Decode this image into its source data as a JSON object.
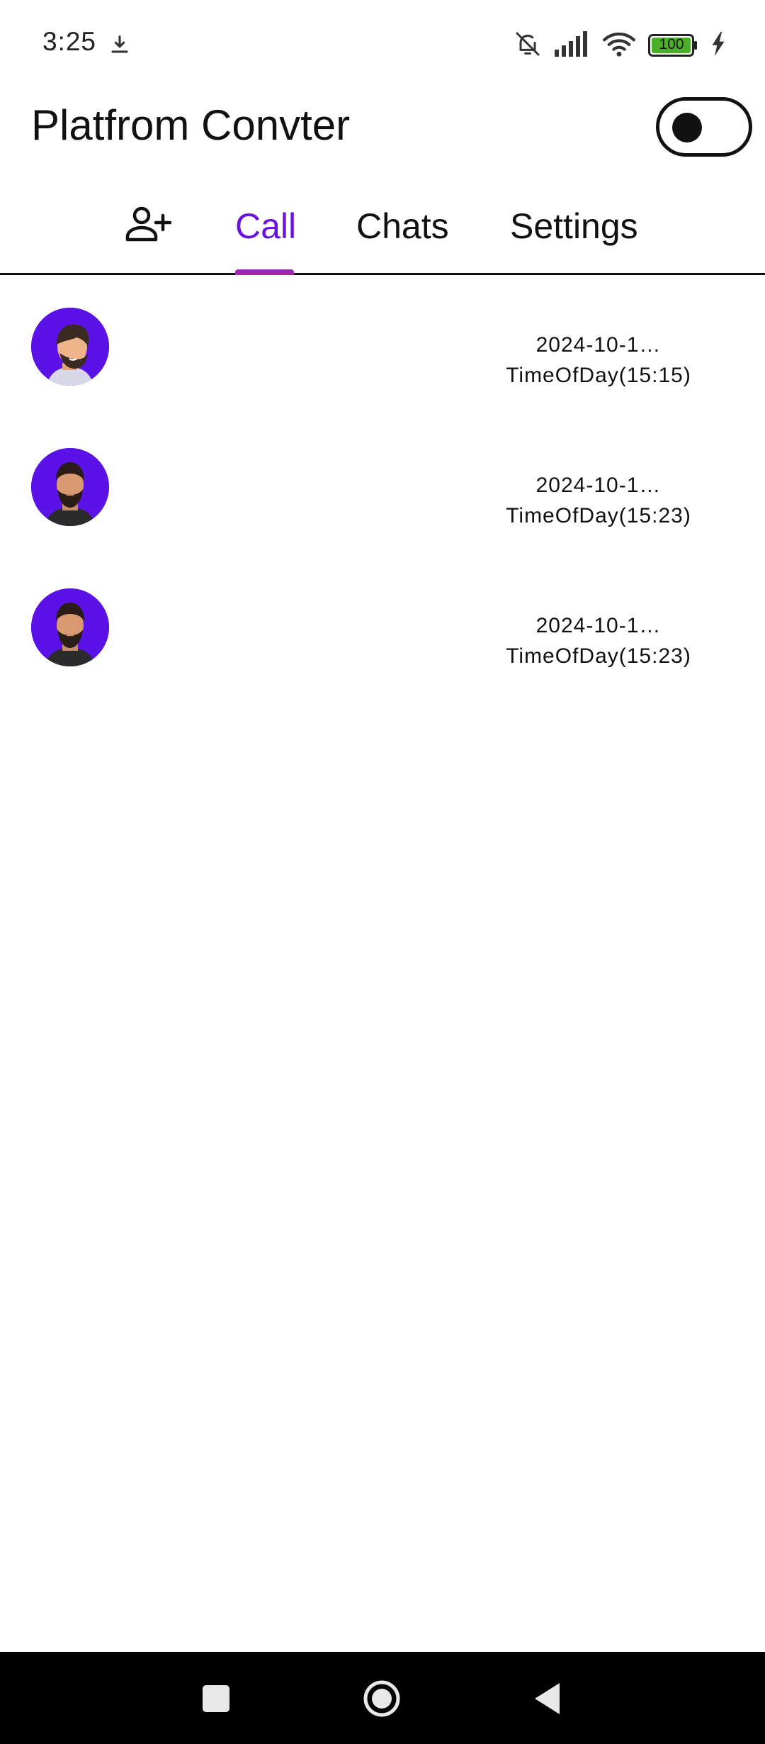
{
  "status_bar": {
    "time": "3:25",
    "battery_level": "100",
    "icons": [
      "download-icon",
      "bell-off-icon",
      "signal-icon",
      "wifi-icon",
      "battery-icon",
      "charging-bolt-icon"
    ]
  },
  "app_bar": {
    "title": "Platfrom Convter",
    "theme_toggle_on": false
  },
  "tabs": {
    "add_icon": "person-add-icon",
    "items": [
      {
        "label": "Call",
        "selected": true
      },
      {
        "label": "Chats",
        "selected": false
      },
      {
        "label": "Settings",
        "selected": false
      }
    ]
  },
  "calls": [
    {
      "avatar": "avatar-man-profile",
      "date": "2024-10-1…",
      "time": "TimeOfDay(15:15)"
    },
    {
      "avatar": "avatar-man-front",
      "date": "2024-10-1…",
      "time": "TimeOfDay(15:23)"
    },
    {
      "avatar": "avatar-man-front",
      "date": "2024-10-1…",
      "time": "TimeOfDay(15:23)"
    }
  ],
  "colors": {
    "accent": "#6a13e0",
    "indicator": "#9c27b0",
    "avatar_bg": "#5a12e6",
    "battery_green": "#4caf2a"
  },
  "nav_bar": {
    "buttons": [
      "recents-button",
      "home-button",
      "back-button"
    ]
  }
}
